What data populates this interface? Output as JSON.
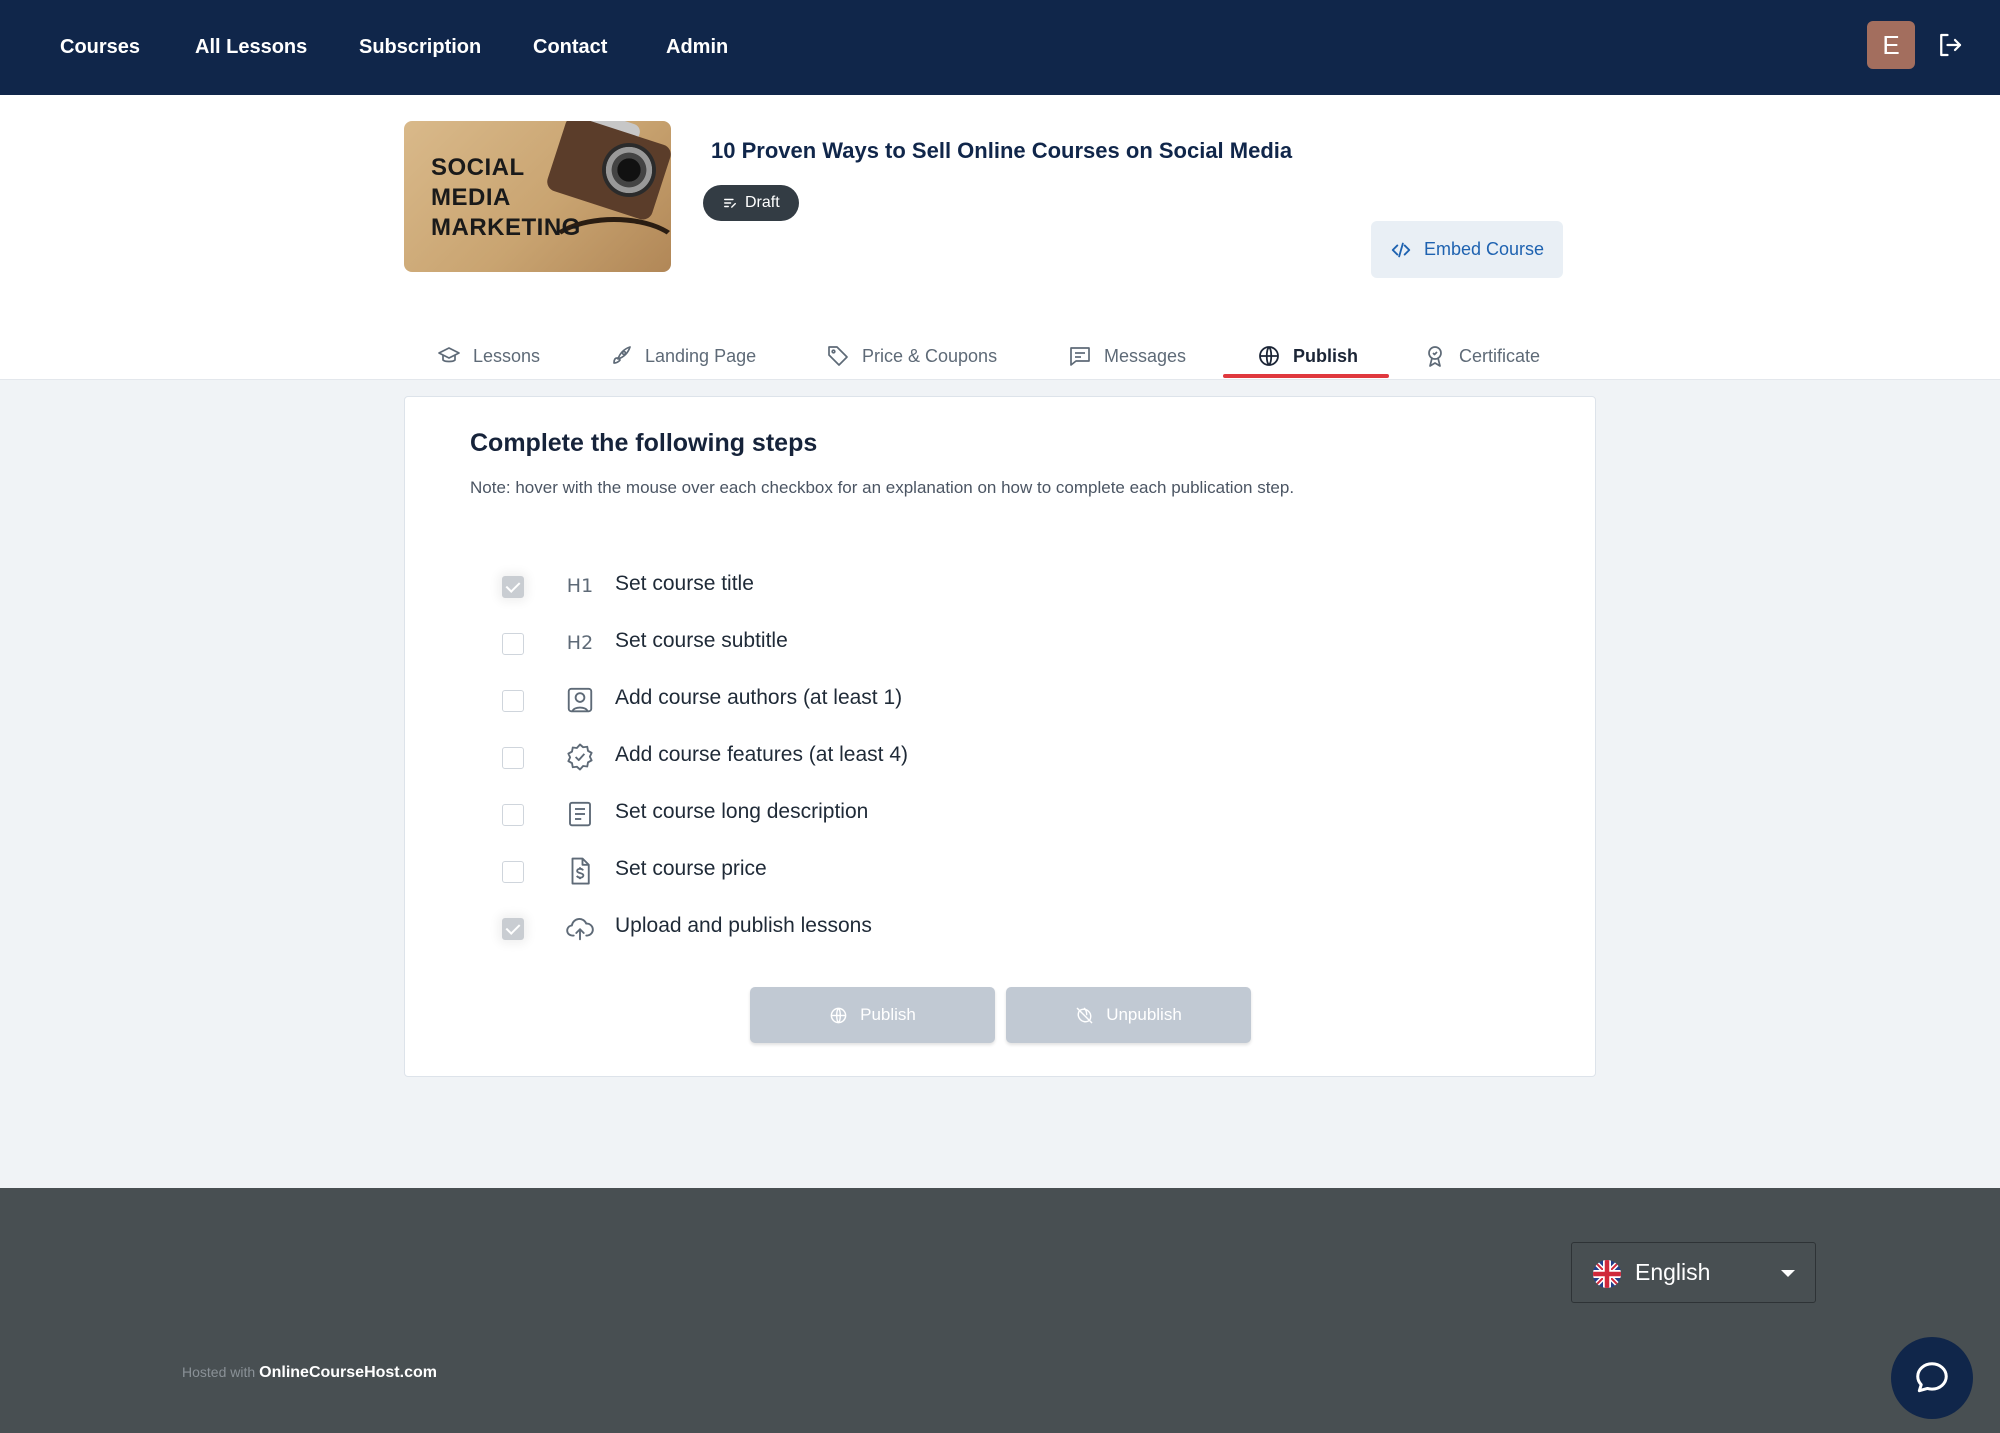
{
  "nav": {
    "items": [
      {
        "label": "Courses"
      },
      {
        "label": "All Lessons"
      },
      {
        "label": "Subscription"
      },
      {
        "label": "Contact"
      },
      {
        "label": "Admin"
      }
    ],
    "avatar_initial": "E"
  },
  "course": {
    "thumbnail_text": "SOCIAL\nMEDIA\nMARKETING",
    "title": "10 Proven Ways to Sell Online Courses on Social Media",
    "status": "Draft",
    "embed_label": "Embed Course"
  },
  "tabs": [
    {
      "label": "Lessons",
      "icon": "mortarboard-icon"
    },
    {
      "label": "Landing Page",
      "icon": "rocket-icon"
    },
    {
      "label": "Price & Coupons",
      "icon": "tag-icon"
    },
    {
      "label": "Messages",
      "icon": "message-icon"
    },
    {
      "label": "Publish",
      "icon": "globe-icon",
      "active": true
    },
    {
      "label": "Certificate",
      "icon": "award-icon"
    }
  ],
  "publish": {
    "heading": "Complete the following steps",
    "note": "Note: hover with the mouse over each checkbox for an explanation on how to complete each publication step.",
    "steps": [
      {
        "label": "Set course title",
        "icon": "h1-icon",
        "checked": true
      },
      {
        "label": "Set course subtitle",
        "icon": "h2-icon",
        "checked": false
      },
      {
        "label": "Add course authors (at least 1)",
        "icon": "user-square-icon",
        "checked": false
      },
      {
        "label": "Add course features (at least 4)",
        "icon": "badge-check-icon",
        "checked": false
      },
      {
        "label": "Set course long description",
        "icon": "document-lines-icon",
        "checked": false
      },
      {
        "label": "Set course price",
        "icon": "file-dollar-icon",
        "checked": false
      },
      {
        "label": "Upload and publish lessons",
        "icon": "cloud-upload-icon",
        "checked": true
      }
    ],
    "publish_label": "Publish",
    "unpublish_label": "Unpublish"
  },
  "footer": {
    "language": "English",
    "hosted_prefix": "Hosted with",
    "brand": "OnlineCourseHost.com"
  },
  "colors": {
    "nav_bg": "#10264a",
    "accent_red": "#e0383e",
    "link_blue": "#1e62b0",
    "footer_bg": "#484f52",
    "disabled_button": "#c1c9d3"
  }
}
